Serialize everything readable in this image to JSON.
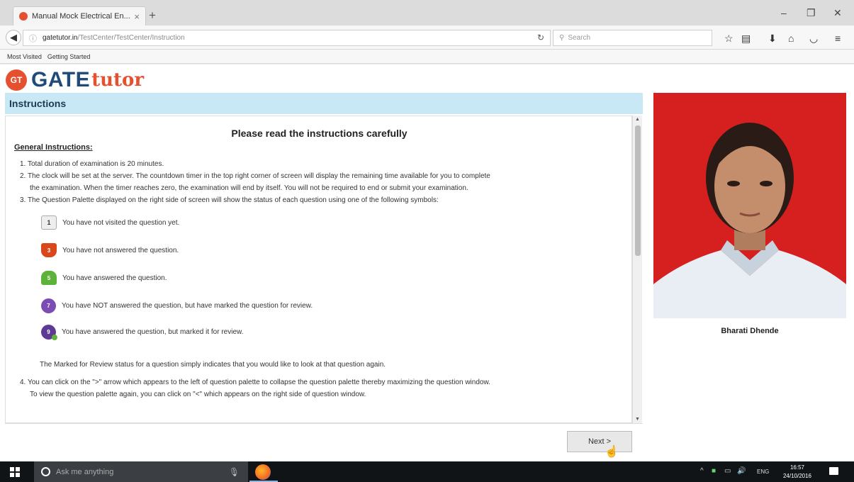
{
  "browser": {
    "tab_title": "Manual Mock Electrical En...",
    "tab_close": "×",
    "new_tab": "+",
    "url_domain": "gatetutor.in",
    "url_path": "/TestCenter/TestCenter/Instruction",
    "search_placeholder": "Search",
    "bookmarks": [
      "Most Visited",
      "Getting Started"
    ],
    "window_controls": [
      "–",
      "❐",
      "✕"
    ]
  },
  "logo": {
    "badge": "GT",
    "gate": "GATE",
    "tutor": "tutor"
  },
  "header": {
    "title": "Instructions"
  },
  "instructions": {
    "heading": "Please read the instructions carefully",
    "general_title": "General Instructions:",
    "item1": "1. Total duration of examination is 20 minutes.",
    "item2_a": "2. The clock will be set at the server. The countdown timer in the top right corner of screen will display the remaining time available for you to complete",
    "item2_b": "the examination. When the timer reaches zero, the examination will end by itself. You will not be required to end or submit your examination.",
    "item3": "3. The Question Palette displayed on the right side of screen will show the status of each question using one of the following symbols:",
    "symbols": [
      {
        "num": "1",
        "text": "You have not visited the question yet."
      },
      {
        "num": "3",
        "text": "You have not answered the question."
      },
      {
        "num": "5",
        "text": "You have answered the question."
      },
      {
        "num": "7",
        "text": "You have NOT answered the question, but have marked the question for review."
      },
      {
        "num": "9",
        "text": "You have answered the question, but marked it for review."
      }
    ],
    "marked_note": "The Marked for Review status for a question simply indicates that you would like to look at that question again.",
    "item4_a": "4. You can click on the \">\" arrow which appears to the left of question palette to collapse the question palette thereby maximizing the question window.",
    "item4_b": "To view the question palette again, you can click on \"<\" which appears on the right side of question window."
  },
  "next_button": "Next >",
  "candidate": {
    "name": "Bharati Dhende"
  },
  "taskbar": {
    "search_placeholder": "Ask me anything",
    "lang": "ENG",
    "time": "16:57",
    "date": "24/10/2016"
  }
}
